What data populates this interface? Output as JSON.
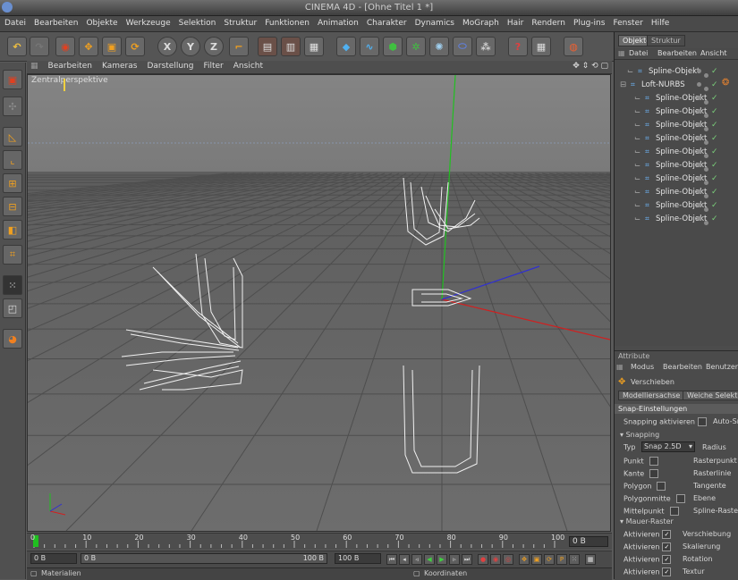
{
  "app": {
    "title": "CINEMA 4D - [Ohne Titel 1 *]"
  },
  "menu": [
    "Datei",
    "Bearbeiten",
    "Objekte",
    "Werkzeuge",
    "Selektion",
    "Struktur",
    "Funktionen",
    "Animation",
    "Charakter",
    "Dynamics",
    "MoGraph",
    "Hair",
    "Rendern",
    "Plug-ins",
    "Fenster",
    "Hilfe"
  ],
  "toolbar": {
    "x_label": "X",
    "y_label": "Y",
    "z_label": "Z"
  },
  "viewport": {
    "menu": [
      "Bearbeiten",
      "Kameras",
      "Darstellung",
      "Filter",
      "Ansicht"
    ],
    "label": "Zentralperspektive",
    "nav_icons": "✥ ⇕ ⟲ ▢"
  },
  "timeline": {
    "ticks": [
      "0",
      "10",
      "20",
      "30",
      "40",
      "50",
      "60",
      "70",
      "80",
      "90",
      "100"
    ],
    "frame": "0 B",
    "current_frame": 0,
    "max_frame": 100
  },
  "transport": {
    "field1": "0 B",
    "field2": "0 B",
    "field3": "100 B",
    "field4": "100 B"
  },
  "status": {
    "left": "Materialien",
    "right": "Koordinaten"
  },
  "object_manager": {
    "tabs": [
      "Objekte",
      "Struktur"
    ],
    "menu": [
      "Datei",
      "Bearbeiten",
      "Ansicht"
    ],
    "items": [
      {
        "name": "Spline-Objekt",
        "indent": 1
      },
      {
        "name": "Loft-NURBS",
        "indent": 0
      },
      {
        "name": "Spline-Objekt",
        "indent": 2
      },
      {
        "name": "Spline-Objekt",
        "indent": 2
      },
      {
        "name": "Spline-Objekt",
        "indent": 2
      },
      {
        "name": "Spline-Objekt",
        "indent": 2
      },
      {
        "name": "Spline-Objekt",
        "indent": 2
      },
      {
        "name": "Spline-Objekt",
        "indent": 2
      },
      {
        "name": "Spline-Objekt",
        "indent": 2
      },
      {
        "name": "Spline-Objekt",
        "indent": 2
      },
      {
        "name": "Spline-Objekt",
        "indent": 2
      },
      {
        "name": "Spline-Objekt",
        "indent": 2
      }
    ]
  },
  "attributes": {
    "title": "Attribute",
    "menu": [
      "Modus",
      "Bearbeiten",
      "Benutzer"
    ],
    "tool": "Verschieben",
    "tabs": [
      "Modelliersachse",
      "Weiche Selektion"
    ],
    "section": "Snap-Einstellungen",
    "snapping_enable": "Snapping aktivieren",
    "auto": "Auto-Snap",
    "group_snapping": "Snapping",
    "typ_label": "Typ",
    "typ_value": "Snap 2.5D",
    "radius_label": "Radius",
    "rows_left": [
      "Punkt",
      "Kante",
      "Polygon",
      "Polygonmitte",
      "Mittelpunkt"
    ],
    "rows_right": [
      "Rasterpunkt",
      "Rasterlinie",
      "Tangente",
      "Ebene",
      "Spline-Raster"
    ],
    "group_raster": "Mauer-Raster",
    "raster_left": [
      "Aktivieren",
      "Aktivieren",
      "Aktivieren",
      "Aktivieren"
    ],
    "raster_right": [
      "Verschiebung",
      "Skalierung",
      "Rotation",
      "Textur"
    ]
  },
  "colors": {
    "x_axis": "#d02020",
    "y_axis": "#20c020",
    "z_axis": "#3030d0",
    "accent": "#f0d040"
  }
}
